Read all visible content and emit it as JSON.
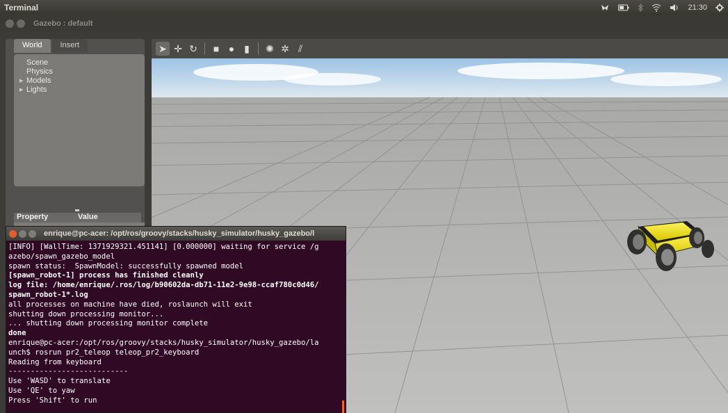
{
  "top_panel": {
    "app_title": "Terminal",
    "clock": "21:30",
    "icons": [
      "app-indicator-icon",
      "battery-icon",
      "bluetooth-icon",
      "wifi-icon",
      "volume-icon",
      "settings-gear-icon"
    ]
  },
  "gazebo": {
    "window_title": "Gazebo : default",
    "tabs": [
      {
        "label": "World",
        "active": true
      },
      {
        "label": "Insert",
        "active": false
      }
    ],
    "tree_items": [
      {
        "label": "Scene",
        "expandable": false
      },
      {
        "label": "Physics",
        "expandable": false
      },
      {
        "label": "Models",
        "expandable": true
      },
      {
        "label": "Lights",
        "expandable": true
      }
    ],
    "property_header": {
      "property": "Property",
      "value": "Value"
    },
    "toolbar_tools": [
      {
        "name": "select-arrow-icon",
        "glyph": "➤",
        "active": true
      },
      {
        "name": "translate-icon",
        "glyph": "✛",
        "active": false
      },
      {
        "name": "rotate-icon",
        "glyph": "↻",
        "active": false
      },
      {
        "name": "box-shape-icon",
        "glyph": "■",
        "active": false
      },
      {
        "name": "sphere-shape-icon",
        "glyph": "●",
        "active": false
      },
      {
        "name": "cylinder-shape-icon",
        "glyph": "▮",
        "active": false
      },
      {
        "name": "point-light-icon",
        "glyph": "✺",
        "active": false
      },
      {
        "name": "spot-light-icon",
        "glyph": "✲",
        "active": false
      },
      {
        "name": "directional-light-icon",
        "glyph": "⫽",
        "active": false
      }
    ]
  },
  "terminal": {
    "title": "enrique@pc-acer: /opt/ros/groovy/stacks/husky_simulator/husky_gazebo/l",
    "lines": [
      {
        "text": "[INFO] [WallTime: 1371929321.451141] [0.000000] waiting for service /g",
        "bold": false
      },
      {
        "text": "azebo/spawn_gazebo_model",
        "bold": false
      },
      {
        "text": "spawn status:  SpawnModel: successfully spawned model",
        "bold": false
      },
      {
        "text": "[spawn_robot-1] process has finished cleanly",
        "bold": true
      },
      {
        "text": "log file: /home/enrique/.ros/log/b90602da-db71-11e2-9e98-ccaf780c0d46/",
        "bold": true
      },
      {
        "text": "spawn_robot-1*.log",
        "bold": true
      },
      {
        "text": "all processes on machine have died, roslaunch will exit",
        "bold": false
      },
      {
        "text": "shutting down processing monitor...",
        "bold": false
      },
      {
        "text": "... shutting down processing monitor complete",
        "bold": false
      },
      {
        "text": "done",
        "bold": true
      },
      {
        "text": "enrique@pc-acer:/opt/ros/groovy/stacks/husky_simulator/husky_gazebo/la",
        "bold": false
      },
      {
        "text": "unch$ rosrun pr2_teleop teleop_pr2_keyboard",
        "bold": false
      },
      {
        "text": "Reading from keyboard",
        "bold": false
      },
      {
        "text": "---------------------------",
        "bold": false
      },
      {
        "text": "Use 'WASD' to translate",
        "bold": false
      },
      {
        "text": "Use 'QE' to yaw",
        "bold": false
      },
      {
        "text": "Press 'Shift' to run",
        "bold": false
      }
    ]
  },
  "colors": {
    "terminal_bg": "#300a24",
    "robot_body": "#f2e600",
    "sky_top": "#9cc3e6",
    "ground": "#b9b9b8"
  }
}
